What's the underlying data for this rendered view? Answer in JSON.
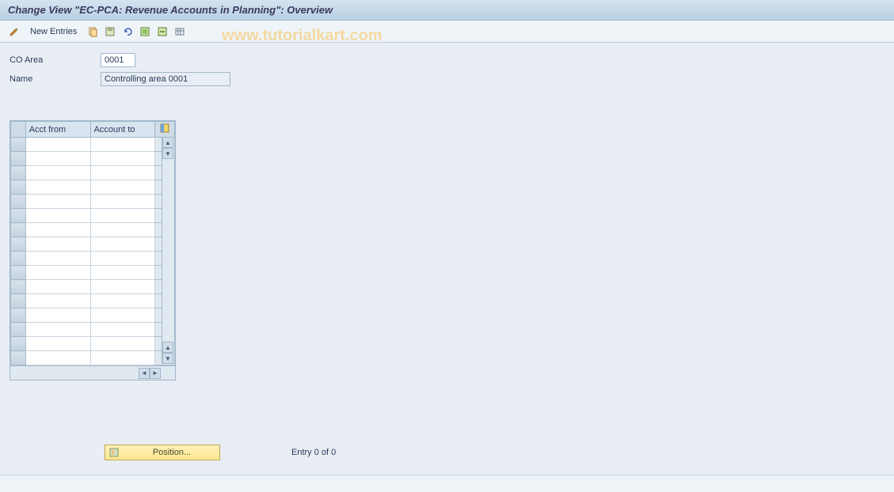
{
  "title": "Change View \"EC-PCA: Revenue Accounts in Planning\": Overview",
  "toolbar": {
    "new_entries": "New Entries"
  },
  "watermark": "www.tutorialkart.com",
  "fields": {
    "co_area_label": "CO Area",
    "co_area_value": "0001",
    "name_label": "Name",
    "name_value": "Controlling area 0001"
  },
  "table": {
    "col1": "Acct from",
    "col2": "Account to",
    "row_count": 16
  },
  "footer": {
    "position_label": "Position...",
    "entry_text": "Entry 0 of 0"
  },
  "chart_data": {
    "type": "table",
    "columns": [
      "Acct from",
      "Account to"
    ],
    "rows": []
  }
}
